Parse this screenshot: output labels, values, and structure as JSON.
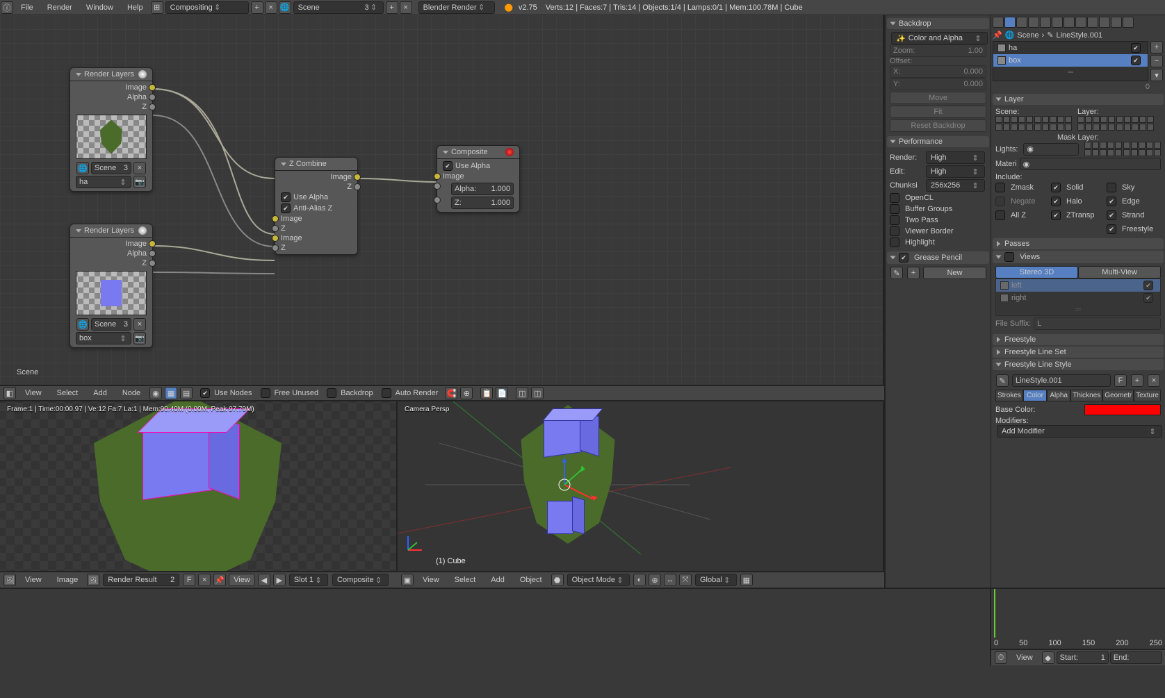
{
  "topbar": {
    "menu": [
      "File",
      "Render",
      "Window",
      "Help"
    ],
    "layout": "Compositing",
    "scene": "Scene",
    "scene_users": "3",
    "engine": "Blender Render",
    "version": "v2.75",
    "stats": "Verts:12 | Faces:7 | Tris:14 | Objects:1/4 | Lamps:0/1 | Mem:100.78M | Cube"
  },
  "nodes": {
    "rl1": {
      "title": "Render Layers",
      "out": [
        "Image",
        "Alpha",
        "Z"
      ],
      "scene": "Scene",
      "scene_users": "3",
      "layer": "ha"
    },
    "rl2": {
      "title": "Render Layers",
      "out": [
        "Image",
        "Alpha",
        "Z"
      ],
      "scene": "Scene",
      "scene_users": "3",
      "layer": "box"
    },
    "zcomb": {
      "title": "Z Combine",
      "out": [
        "Image",
        "Z"
      ],
      "use_alpha": "Use Alpha",
      "anti_alias": "Anti-Alias Z",
      "in": [
        "Image",
        "Z",
        "Image",
        "Z"
      ]
    },
    "comp": {
      "title": "Composite",
      "use_alpha": "Use Alpha",
      "in_image": "Image",
      "alpha_l": "Alpha:",
      "alpha_v": "1.000",
      "z_l": "Z:",
      "z_v": "1.000"
    }
  },
  "scene_corner": "Scene",
  "node_toolbar": {
    "menu": [
      "View",
      "Select",
      "Add",
      "Node"
    ],
    "use_nodes": "Use Nodes",
    "free_unused": "Free Unused",
    "backdrop": "Backdrop",
    "auto_render": "Auto Render"
  },
  "viewport1": {
    "stats": "Frame:1 | Time:00:00.97 | Ve:12 Fa:7 La:1 | Mem:90.40M (0.00M, Peak 97.79M)"
  },
  "viewport2": {
    "persp": "Camera Persp",
    "obj": "(1) Cube"
  },
  "img_toolbar": {
    "menu": [
      "View",
      "Image"
    ],
    "result": "Render Result",
    "users": "2",
    "f": "F",
    "slot": "Slot 1",
    "pass": "Composite"
  },
  "vp_toolbar": {
    "view": "View",
    "select": "Select",
    "add": "Add",
    "object": "Object",
    "mode": "Object Mode",
    "shading": "Global"
  },
  "backdrop_panel": {
    "title": "Backdrop",
    "mode": "Color and Alpha",
    "zoom_l": "Zoom:",
    "zoom_v": "1.00",
    "offset": "Offset:",
    "x_l": "X:",
    "x_v": "0.000",
    "y_l": "Y:",
    "y_v": "0.000",
    "move": "Move",
    "fit": "Fit",
    "reset": "Reset Backdrop"
  },
  "performance": {
    "title": "Performance",
    "render_l": "Render:",
    "render": "High",
    "edit_l": "Edit:",
    "edit": "High",
    "chunk_l": "Chunksi",
    "chunk": "256x256",
    "opencl": "OpenCL",
    "buffer": "Buffer Groups",
    "twopass": "Two Pass",
    "viewer": "Viewer Border",
    "highlight": "Highlight"
  },
  "grease": {
    "title": "Grease Pencil",
    "new": "New"
  },
  "right": {
    "breadcrumb_scene": "Scene",
    "breadcrumb_linestyle": "LineStyle.001",
    "list": [
      "ha",
      "box"
    ],
    "list_count": "0",
    "layer_title": "Layer",
    "scene_l": "Scene:",
    "layer_l": "Layer:",
    "mask_l": "Mask Layer:",
    "lights": "Lights:",
    "materi": "Materi",
    "include": "Include:",
    "inc": [
      "Zmask",
      "Solid",
      "Sky",
      "Negate",
      "Halo",
      "Edge",
      "All Z",
      "ZTransp",
      "Strand",
      "Freestyle"
    ],
    "passes": "Passes",
    "views": "Views",
    "stereo": "Stereo 3D",
    "multi": "Multi-View",
    "left": "left",
    "right": "right",
    "suffix": "File Suffix:",
    "suffix_v": "L",
    "freestyle": "Freestyle",
    "fls": "Freestyle Line Set",
    "flstyle": "Freestyle Line Style",
    "linestyle": "LineStyle.001",
    "f": "F",
    "tabs": [
      "Strokes",
      "Color",
      "Alpha",
      "Thicknes",
      "Geometr",
      "Texture"
    ],
    "base_color": "Base Color:",
    "modifiers": "Modifiers:",
    "add_mod": "Add Modifier"
  },
  "timeline": {
    "ticks": [
      "0",
      "50",
      "100",
      "150",
      "200",
      "250"
    ],
    "view": "View",
    "start_l": "Start:",
    "start_v": "1",
    "end_l": "End:"
  }
}
